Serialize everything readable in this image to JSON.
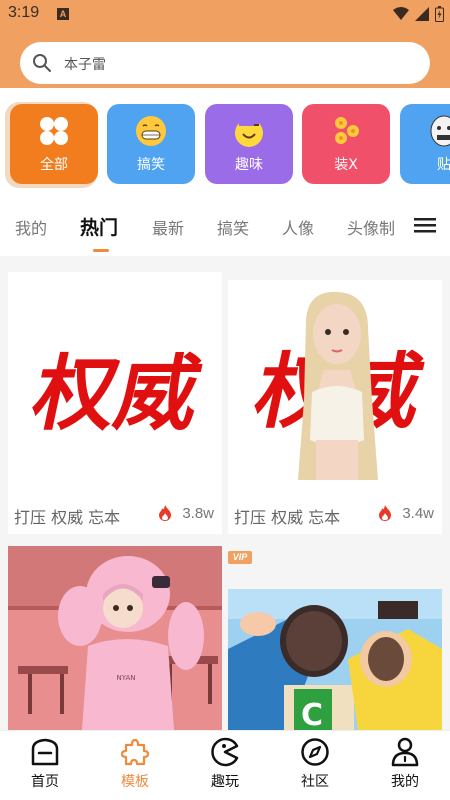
{
  "status": {
    "time": "3:19",
    "badge": "A"
  },
  "search": {
    "placeholder": "本子雷"
  },
  "categories": [
    {
      "label": "全部",
      "icon": "grid-icon",
      "color": "#F27D1F"
    },
    {
      "label": "搞笑",
      "icon": "grin-emoji-icon",
      "color": "#4FA3F0"
    },
    {
      "label": "趣味",
      "icon": "wink-face-icon",
      "color": "#9B6CE8"
    },
    {
      "label": "装X",
      "icon": "coins-icon",
      "color": "#F0506A"
    },
    {
      "label": "贴",
      "icon": "meme-face-icon",
      "color": "#4FA3F0"
    }
  ],
  "tabs": [
    {
      "label": "我的"
    },
    {
      "label": "热门"
    },
    {
      "label": "最新"
    },
    {
      "label": "搞笑"
    },
    {
      "label": "人像"
    },
    {
      "label": "头像制"
    }
  ],
  "cards": [
    {
      "title": "打压 权威 忘本",
      "count": "3.8w",
      "image_text": "权威"
    },
    {
      "title": "打压 权威 忘本",
      "count": "3.4w",
      "image_text": "权威"
    },
    {
      "caption": "NYAN"
    },
    {
      "vip": "VIP"
    }
  ],
  "nav": [
    {
      "label": "首页",
      "icon": "home-icon"
    },
    {
      "label": "模板",
      "icon": "puzzle-icon"
    },
    {
      "label": "趣玩",
      "icon": "pacman-icon"
    },
    {
      "label": "社区",
      "icon": "compass-icon"
    },
    {
      "label": "我的",
      "icon": "person-icon"
    }
  ],
  "colors": {
    "accent": "#F08A3C",
    "header": "#F0A060"
  }
}
